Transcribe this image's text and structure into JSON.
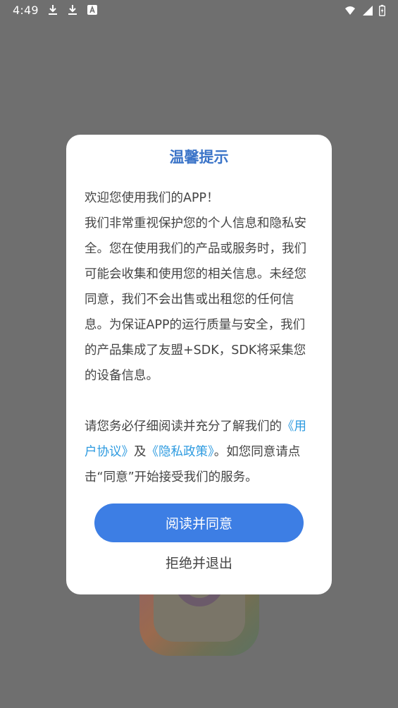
{
  "status_bar": {
    "time": "4:49",
    "left_icons": [
      "download-icon",
      "download-icon",
      "text-a-icon"
    ],
    "right_icons": [
      "wifi-icon",
      "signal-icon",
      "battery-charging-icon"
    ]
  },
  "dialog": {
    "title": "温馨提示",
    "paragraph1": "欢迎您使用我们的APP！\n我们非常重视保护您的个人信息和隐私安全。您在使用我们的产品或服务时，我们可能会收集和使用您的相关信息。未经您同意，我们不会出售或出租您的任何信息。为保证APP的运行质量与安全，我们的产品集成了友盟+SDK，SDK将采集您的设备信息。",
    "paragraph2_prefix": "请您务必仔细阅读并充分了解我们的",
    "user_agreement_link": "《用户协议》",
    "and": "及",
    "privacy_policy_link": "《隐私政策》",
    "paragraph2_suffix": "。如您同意请点击“同意”开始接受我们的服务。",
    "agree_button": "阅读并同意",
    "reject_button": "拒绝并退出"
  },
  "colors": {
    "accent": "#3d7ee4",
    "title": "#3b74c8",
    "link": "#2e9be0",
    "overlay": "#6f6f6f"
  }
}
